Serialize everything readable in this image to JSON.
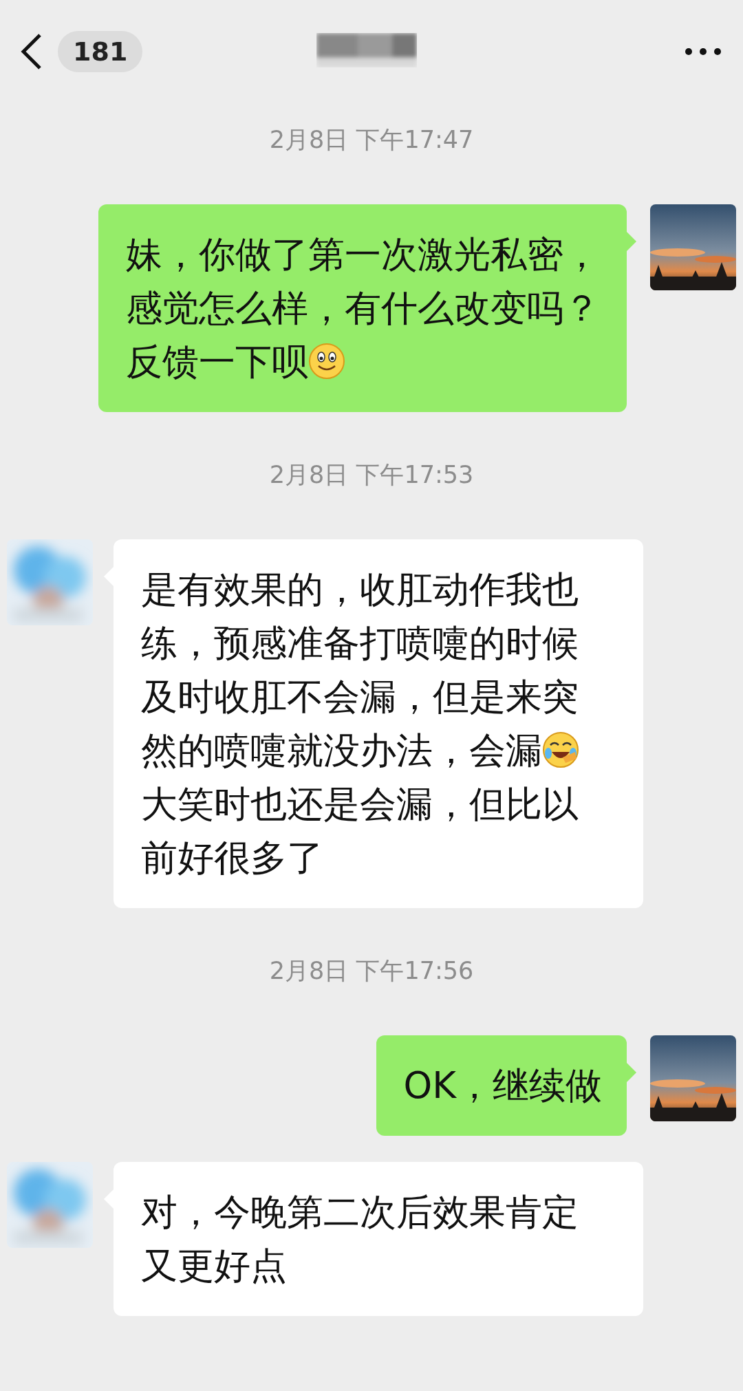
{
  "header": {
    "unread_count": "181"
  },
  "messages": [
    {
      "kind": "time",
      "text": "2月8日 下午17:47"
    },
    {
      "kind": "bubble",
      "outgoing": true,
      "parts": [
        {
          "kind": "text",
          "text": "妹，你做了第一次激光私密，感觉怎么样，有什么改变吗？反馈一下呗"
        },
        {
          "kind": "smile"
        }
      ]
    },
    {
      "kind": "time",
      "text": "2月8日 下午17:53"
    },
    {
      "kind": "bubble",
      "outgoing": false,
      "parts": [
        {
          "kind": "text",
          "text": "是有效果的，收肛动作我也练，预感准备打喷嚏的时候及时收肛不会漏，但是来突然的喷嚏就没办法，会漏"
        },
        {
          "kind": "laughing"
        },
        {
          "kind": "text",
          "text": "大笑时也还是会漏，但比以前好很多了"
        }
      ]
    },
    {
      "kind": "time",
      "text": "2月8日 下午17:56"
    },
    {
      "kind": "bubble",
      "outgoing": true,
      "parts": [
        {
          "kind": "text",
          "text": "OK，继续做"
        }
      ]
    },
    {
      "kind": "bubble",
      "outgoing": false,
      "parts": [
        {
          "kind": "text",
          "text": "对，今晚第二次后效果肯定又更好点"
        }
      ]
    }
  ]
}
